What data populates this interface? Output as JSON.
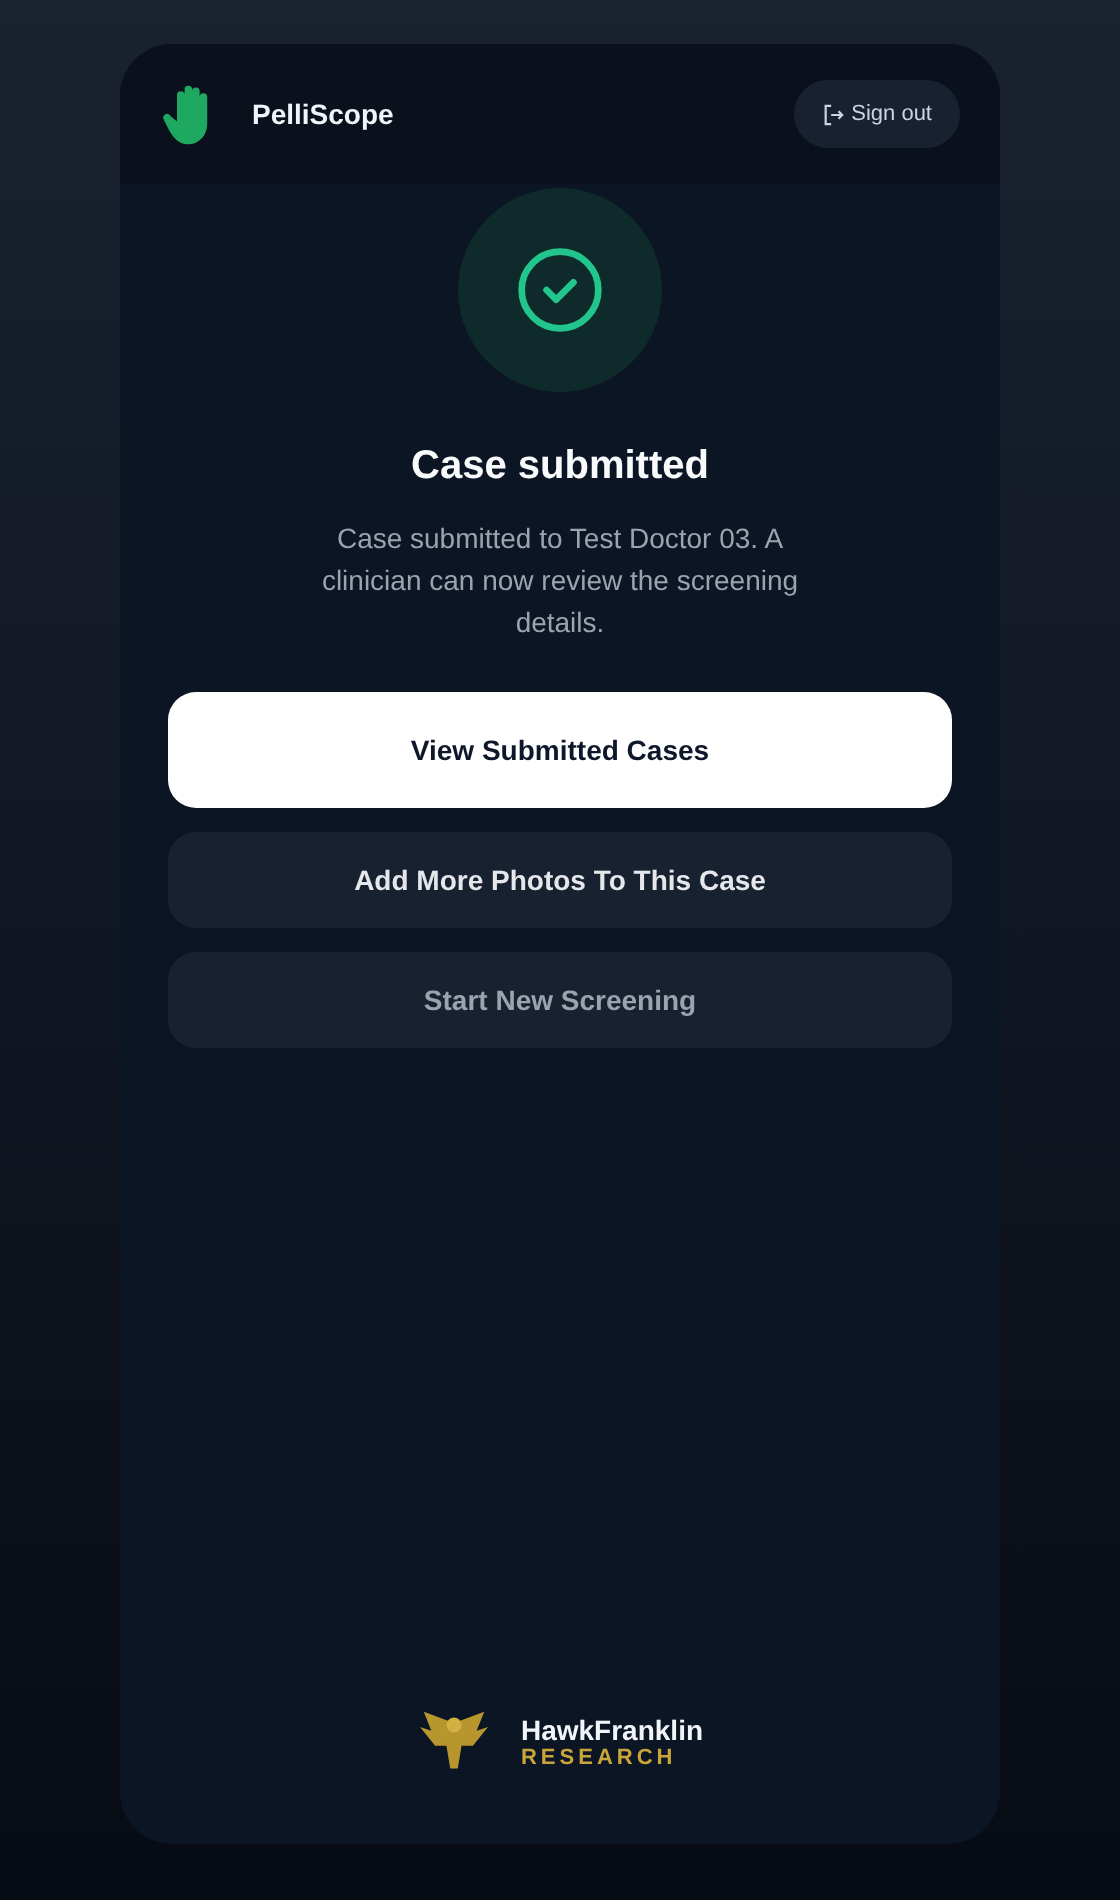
{
  "header": {
    "brand": "PelliScope",
    "sign_out": "Sign out"
  },
  "status": {
    "title": "Case submitted",
    "message": "Case submitted to Test Doctor 03. A clinician can now review the screening details."
  },
  "buttons": [
    {
      "label": "View Submitted Cases",
      "kind": "primary",
      "disabled": false
    },
    {
      "label": "Add More Photos To This Case",
      "kind": "secondary",
      "disabled": false
    },
    {
      "label": "Start New Screening",
      "kind": "secondary",
      "disabled": true
    }
  ],
  "footer": {
    "name": "HawkFranklin",
    "tagline": "RESEARCH"
  }
}
